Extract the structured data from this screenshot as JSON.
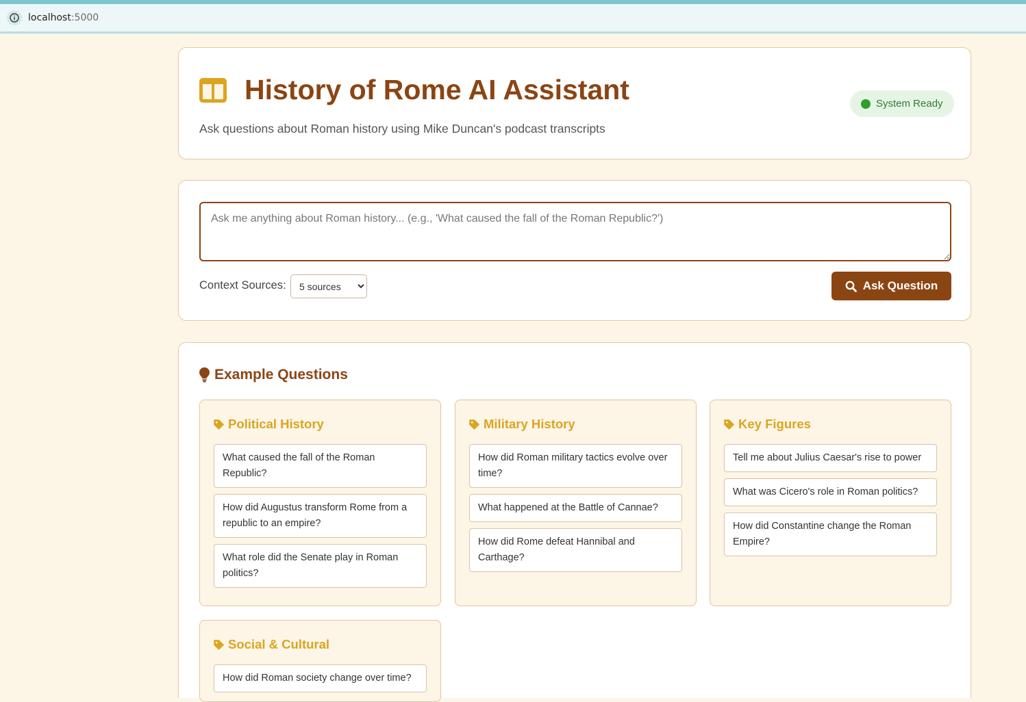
{
  "browser": {
    "url_host": "localhost",
    "url_port": ":5000"
  },
  "header": {
    "title": "History of Rome AI Assistant",
    "subtitle": "Ask questions about Roman history using Mike Duncan's podcast transcripts",
    "status": "System Ready",
    "logo_icon": "columns-icon"
  },
  "question_form": {
    "placeholder": "Ask me anything about Roman history... (e.g., 'What caused the fall of the Roman Republic?')",
    "value": "",
    "context_label": "Context Sources:",
    "sources_selected": "5 sources",
    "ask_button": "Ask Question"
  },
  "examples": {
    "heading": "Example Questions",
    "categories": [
      {
        "title": "Political History",
        "questions": [
          "What caused the fall of the Roman Republic?",
          "How did Augustus transform Rome from a republic to an empire?",
          "What role did the Senate play in Roman politics?"
        ]
      },
      {
        "title": "Military History",
        "questions": [
          "How did Roman military tactics evolve over time?",
          "What happened at the Battle of Cannae?",
          "How did Rome defeat Hannibal and Carthage?"
        ]
      },
      {
        "title": "Key Figures",
        "questions": [
          "Tell me about Julius Caesar's rise to power",
          "What was Cicero's role in Roman politics?",
          "How did Constantine change the Roman Empire?"
        ]
      },
      {
        "title": "Social & Cultural",
        "questions": [
          "How did Roman society change over time?"
        ]
      }
    ]
  },
  "colors": {
    "brand": "#8b4513",
    "accent": "#daa520",
    "background": "#fdf5e6",
    "status_green": "#2e9e2e"
  }
}
